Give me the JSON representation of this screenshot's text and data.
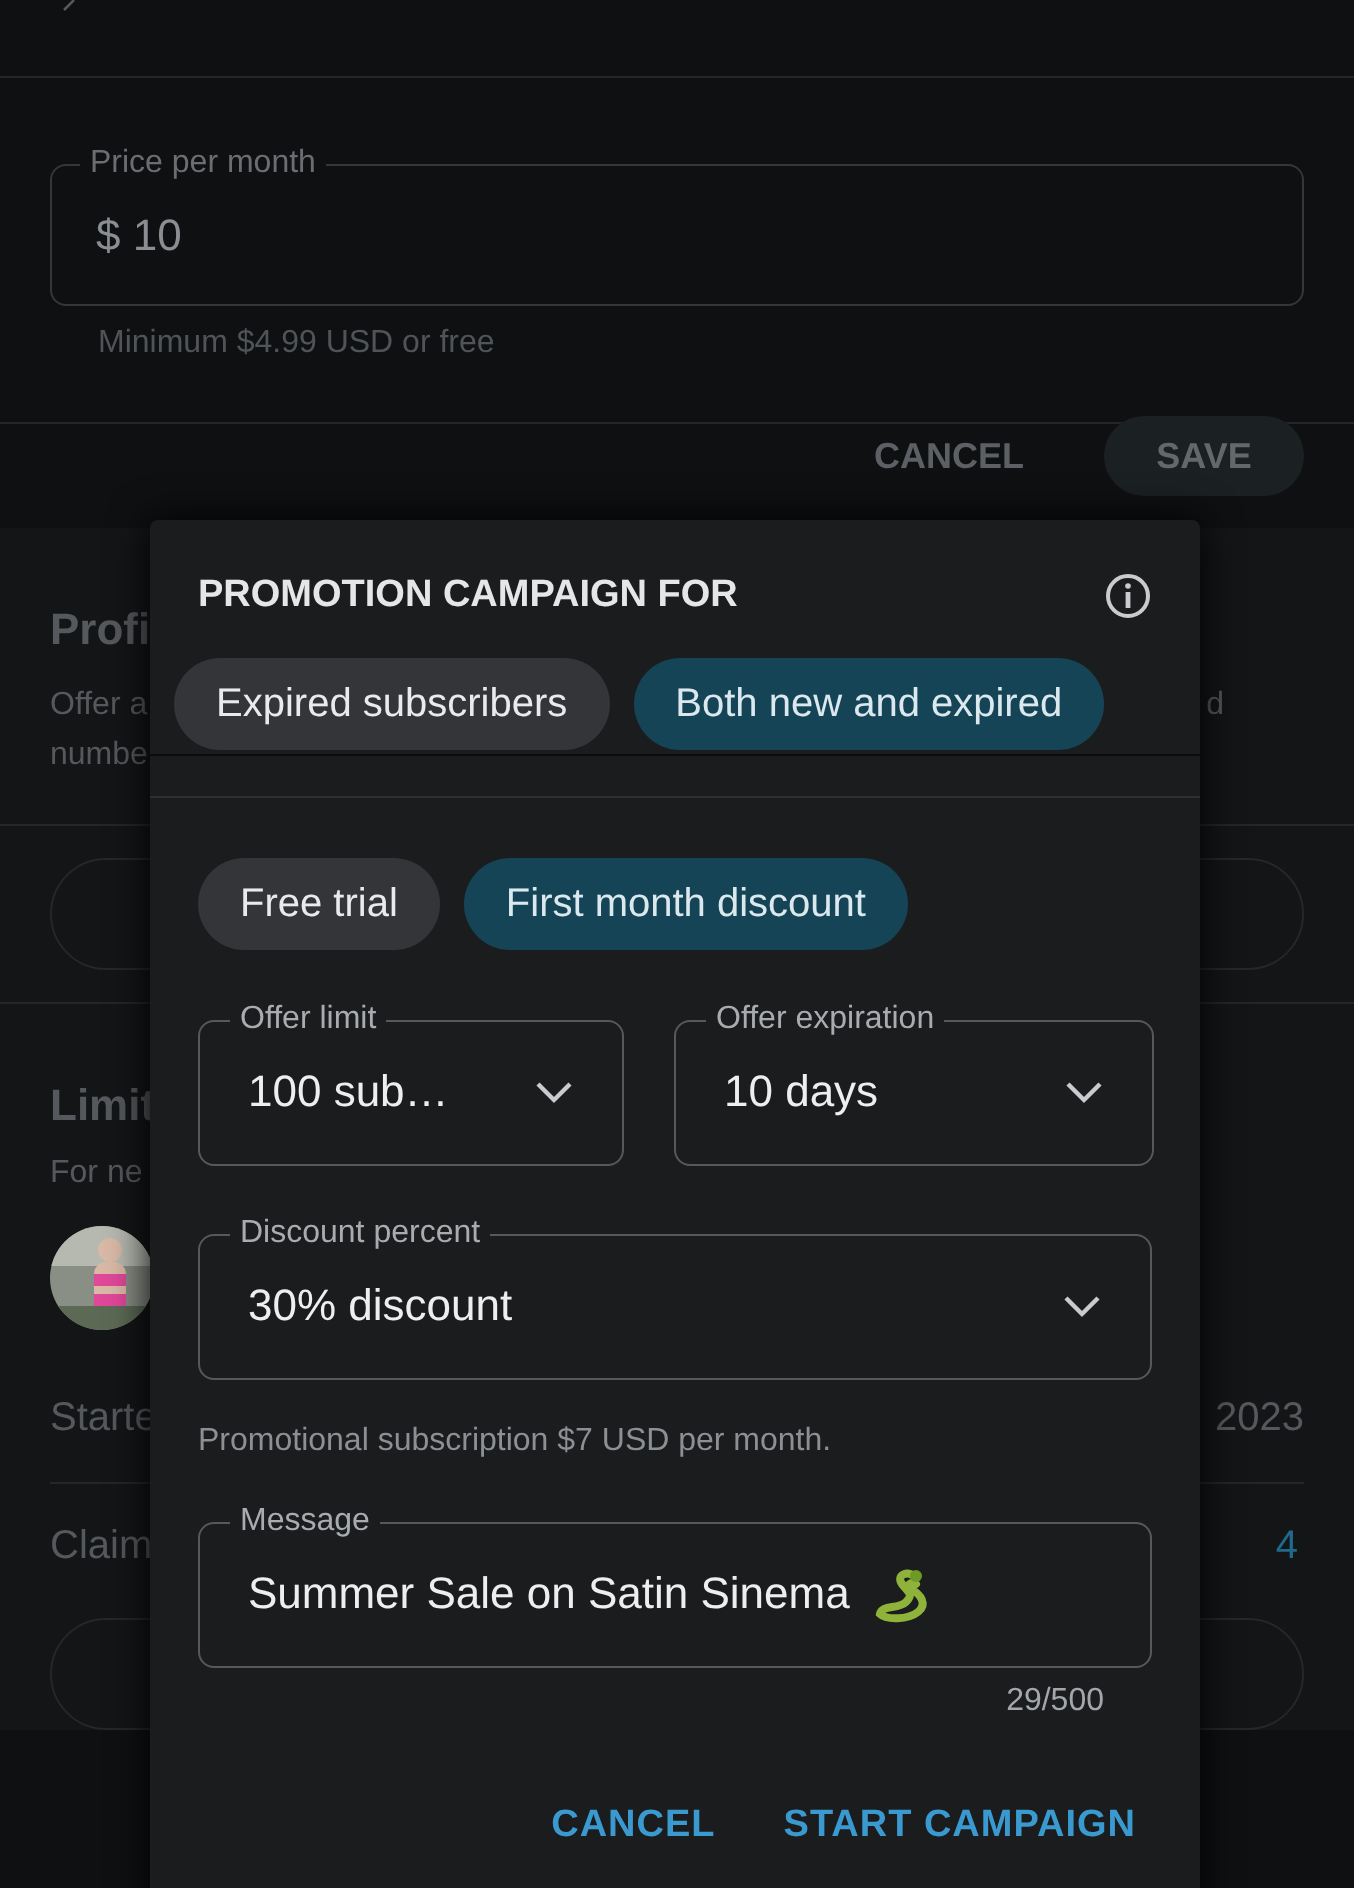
{
  "price_field": {
    "label": "Price per month",
    "value": "$ 10",
    "helper": "Minimum $4.99 USD or free"
  },
  "price_actions": [
    "CANCEL",
    "SAVE"
  ],
  "profile_section": {
    "title": "Profi",
    "description_lines": [
      "Offer a",
      "numbe"
    ],
    "description_end": "d"
  },
  "limited_section": {
    "title": "Limit",
    "subtitle": "For ne",
    "started_label": "Starte",
    "started_value": "2023",
    "claimed_label": "Claim",
    "claimed_value": "4"
  },
  "dialog": {
    "title": "PROMOTION CAMPAIGN FOR",
    "audience": [
      {
        "label": "Expired subscribers",
        "selected": false
      },
      {
        "label": "Both new and expired",
        "selected": true
      }
    ],
    "offer_types": [
      {
        "label": "Free trial",
        "selected": false
      },
      {
        "label": "First month discount",
        "selected": true
      }
    ],
    "offer_limit": {
      "label": "Offer limit",
      "value": "100 sub…"
    },
    "offer_expiration": {
      "label": "Offer expiration",
      "value": "10 days"
    },
    "discount_percent": {
      "label": "Discount percent",
      "value": "30% discount"
    },
    "promo_note": "Promotional subscription $7 USD per month.",
    "message": {
      "label": "Message",
      "value": "Summer Sale on Satin Sinema",
      "counter": "29/500"
    },
    "buttons": [
      "CANCEL",
      "START CAMPAIGN"
    ]
  }
}
